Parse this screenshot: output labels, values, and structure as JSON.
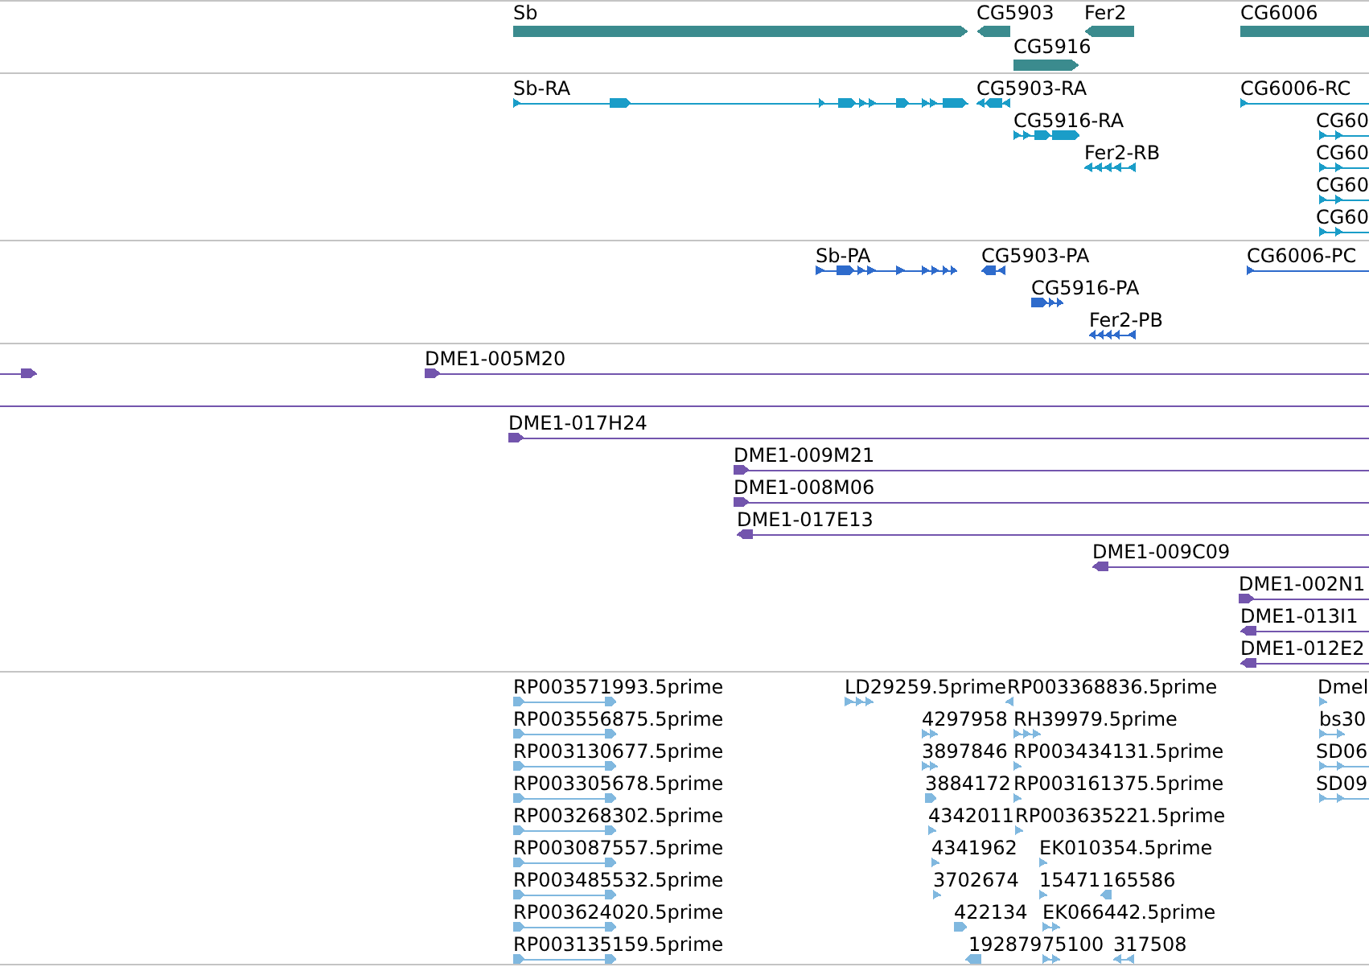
{
  "tracks": [
    {
      "kind": "gene",
      "features": [
        {
          "label": "Sb",
          "reverse": false
        },
        {
          "label": "CG5903",
          "reverse": true
        },
        {
          "label": "Fer2",
          "reverse": true
        },
        {
          "label": "CG6006"
        },
        {
          "label": "CG5916",
          "reverse": false
        }
      ]
    },
    {
      "kind": "transcript",
      "features": [
        {
          "label": "Sb-RA",
          "reverse": false
        },
        {
          "label": "CG5903-RA",
          "reverse": true
        },
        {
          "label": "CG6006-RC",
          "reverse": false
        },
        {
          "label": "CG5916-RA",
          "reverse": false
        },
        {
          "label": "CG60",
          "reverse": false
        },
        {
          "label": "Fer2-RB",
          "reverse": true
        },
        {
          "label": "CG60",
          "reverse": false
        },
        {
          "label": "CG60",
          "reverse": false
        },
        {
          "label": "CG60",
          "reverse": false
        }
      ]
    },
    {
      "kind": "protein",
      "features": [
        {
          "label": "Sb-PA",
          "reverse": false
        },
        {
          "label": "CG5903-PA",
          "reverse": true
        },
        {
          "label": "CG6006-PC",
          "reverse": false
        },
        {
          "label": "CG5916-PA",
          "reverse": false
        },
        {
          "label": "Fer2-PB",
          "reverse": true
        }
      ]
    },
    {
      "kind": "clone",
      "features": [
        {
          "reverse": false
        },
        {
          "label": "DME1-005M20",
          "reverse": false
        },
        {
          "label": "DME1-017H24",
          "reverse": false
        },
        {
          "label": "DME1-009M21",
          "reverse": false
        },
        {
          "label": "DME1-008M06",
          "reverse": false
        },
        {
          "label": "DME1-017E13",
          "reverse": true
        },
        {
          "label": "DME1-009C09",
          "reverse": true
        },
        {
          "label": "DME1-002N1",
          "reverse": false
        },
        {
          "label": "DME1-013I1",
          "reverse": true
        },
        {
          "label": "DME1-012E2",
          "reverse": true
        }
      ]
    },
    {
      "kind": "est",
      "features": [
        {
          "label": "RP003571993.5prime",
          "reverse": false
        },
        {
          "label": "LD29259.5prime",
          "reverse": false
        },
        {
          "label": "RP003368836.5prime",
          "reverse": true
        },
        {
          "label": "Dmel",
          "reverse": false
        },
        {
          "label": "RP003556875.5prime",
          "reverse": false
        },
        {
          "label": "4297958",
          "reverse": false
        },
        {
          "label": "RH39979.5prime",
          "reverse": false
        },
        {
          "label": "bs30",
          "reverse": false
        },
        {
          "label": "RP003130677.5prime",
          "reverse": false
        },
        {
          "label": "3897846",
          "reverse": false
        },
        {
          "label": "RP003434131.5prime",
          "reverse": false
        },
        {
          "label": "SD06",
          "reverse": false
        },
        {
          "label": "RP003305678.5prime",
          "reverse": false
        },
        {
          "label": "3884172",
          "reverse": false
        },
        {
          "label": "RP003161375.5prime",
          "reverse": false
        },
        {
          "label": "SD09",
          "reverse": false
        },
        {
          "label": "RP003268302.5prime",
          "reverse": false
        },
        {
          "label": "4342011",
          "reverse": false
        },
        {
          "label": "RP003635221.5prime",
          "reverse": false
        },
        {
          "label": "RP003087557.5prime",
          "reverse": false
        },
        {
          "label": "4341962",
          "reverse": false
        },
        {
          "label": "EK010354.5prime",
          "reverse": false
        },
        {
          "label": "RP003485532.5prime",
          "reverse": false
        },
        {
          "label": "3702674",
          "reverse": false
        },
        {
          "label": "15471",
          "reverse": false
        },
        {
          "label": "165586",
          "reverse": true
        },
        {
          "label": "RP003624020.5prime",
          "reverse": false
        },
        {
          "label": "422134",
          "reverse": false
        },
        {
          "label": "EK066442.5prime",
          "reverse": false
        },
        {
          "label": "RP003135159.5prime",
          "reverse": false
        },
        {
          "label": "192879",
          "reverse": true
        },
        {
          "label": "75100",
          "reverse": false
        },
        {
          "label": "317508",
          "reverse": true
        }
      ]
    }
  ]
}
